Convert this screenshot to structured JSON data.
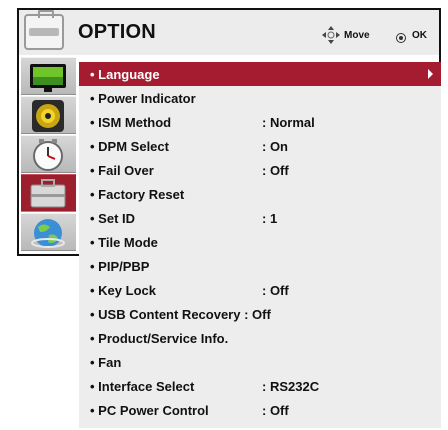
{
  "header": {
    "title": "OPTION",
    "move_label": "Move",
    "ok_label": "OK"
  },
  "sidebar": {
    "tabs": [
      {
        "icon": "picture-icon"
      },
      {
        "icon": "audio-icon"
      },
      {
        "icon": "time-icon"
      },
      {
        "icon": "option-icon",
        "selected": true
      },
      {
        "icon": "network-icon"
      }
    ]
  },
  "menu": {
    "items": [
      {
        "label": "• Language",
        "value": "",
        "selected": true
      },
      {
        "label": "• Power Indicator",
        "value": ""
      },
      {
        "label": "• ISM Method",
        "value": ": Normal"
      },
      {
        "label": "• DPM Select",
        "value": ": On"
      },
      {
        "label": "• Fail Over",
        "value": ": Off"
      },
      {
        "label": "• Factory Reset",
        "value": ""
      },
      {
        "label": "• Set ID",
        "value": ": 1"
      },
      {
        "label": "• Tile Mode",
        "value": ""
      },
      {
        "label": "• PIP/PBP",
        "value": ""
      },
      {
        "label": "• Key Lock",
        "value": ": Off"
      },
      {
        "label": "• USB Content Recovery : Off",
        "value": ""
      },
      {
        "label": "• Product/Service Info.",
        "value": ""
      },
      {
        "label": "• Fan",
        "value": ""
      },
      {
        "label": "• Interface Select",
        "value": ": RS232C"
      },
      {
        "label": "• PC Power Control",
        "value": ": Off"
      }
    ]
  },
  "colors": {
    "accent": "#a51c30",
    "header_bg": "#ececec",
    "list_bg": "#ededed"
  }
}
